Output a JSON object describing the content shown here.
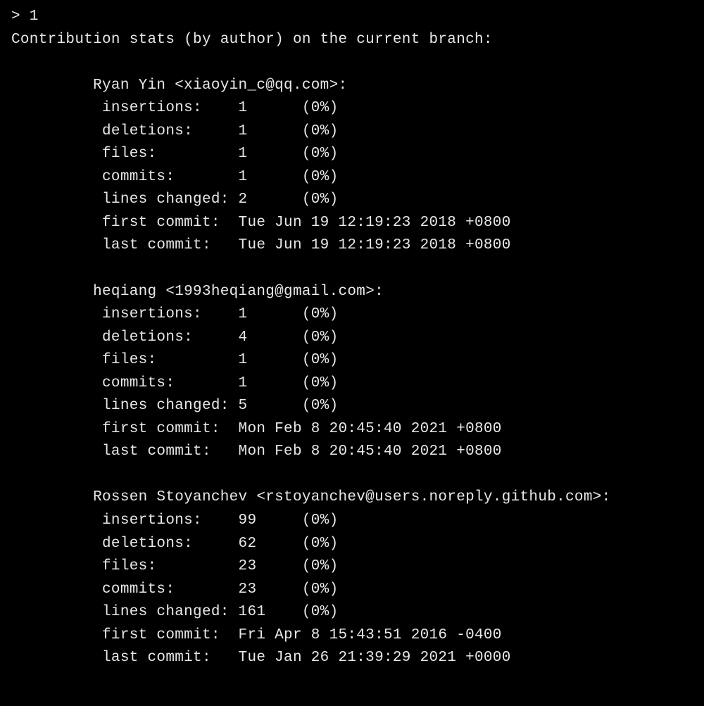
{
  "prompt": "> 1",
  "header": "Contribution stats (by author) on the current branch:",
  "labels": {
    "insertions": "insertions:",
    "deletions": "deletions:",
    "files": "files:",
    "commits": "commits:",
    "lines_changed": "lines changed:",
    "first_commit": "first commit:",
    "last_commit": "last commit:"
  },
  "authors": [
    {
      "name": "Ryan Yin <xiaoyin_c@qq.com>:",
      "insertions": "1",
      "insertions_pct": "(0%)",
      "deletions": "1",
      "deletions_pct": "(0%)",
      "files": "1",
      "files_pct": "(0%)",
      "commits": "1",
      "commits_pct": "(0%)",
      "lines_changed": "2",
      "lines_changed_pct": "(0%)",
      "first_commit": "Tue Jun 19 12:19:23 2018 +0800",
      "last_commit": "Tue Jun 19 12:19:23 2018 +0800"
    },
    {
      "name": "heqiang <1993heqiang@gmail.com>:",
      "insertions": "1",
      "insertions_pct": "(0%)",
      "deletions": "4",
      "deletions_pct": "(0%)",
      "files": "1",
      "files_pct": "(0%)",
      "commits": "1",
      "commits_pct": "(0%)",
      "lines_changed": "5",
      "lines_changed_pct": "(0%)",
      "first_commit": "Mon Feb 8 20:45:40 2021 +0800",
      "last_commit": "Mon Feb 8 20:45:40 2021 +0800"
    },
    {
      "name": "Rossen Stoyanchev <rstoyanchev@users.noreply.github.com>:",
      "insertions": "99",
      "insertions_pct": "(0%)",
      "deletions": "62",
      "deletions_pct": "(0%)",
      "files": "23",
      "files_pct": "(0%)",
      "commits": "23",
      "commits_pct": "(0%)",
      "lines_changed": "161",
      "lines_changed_pct": "(0%)",
      "first_commit": "Fri Apr 8 15:43:51 2016 -0400",
      "last_commit": "Tue Jan 26 21:39:29 2021 +0000"
    }
  ]
}
